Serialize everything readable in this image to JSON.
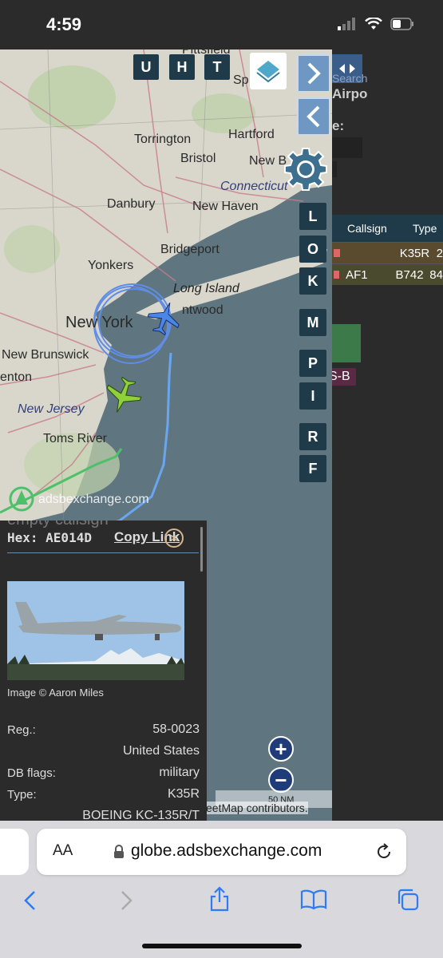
{
  "status_bar": {
    "time": "4:59"
  },
  "map": {
    "labels": {
      "torrington": "Torrington",
      "hartford": "Hartford",
      "bristol": "Bristol",
      "new_britain": "New B",
      "connecticut": "Connecticut",
      "danbury": "Danbury",
      "new_haven": "New Haven",
      "bridgeport": "Bridgeport",
      "yonkers": "Yonkers",
      "long_island": "Long Island",
      "brentwood": "ntwood",
      "new_york": "New York",
      "new_brunswick": "New Brunswick",
      "trenton": "enton",
      "new_jersey": "New Jersey",
      "toms_river": "Toms River",
      "pittsfield": "Pittsfield",
      "springfield": "Sp"
    },
    "top_buttons": [
      "U",
      "H",
      "T"
    ],
    "side_buttons": [
      "L",
      "O",
      "K",
      "M",
      "P",
      "I",
      "R",
      "F"
    ],
    "watermark": "adsbexchange.com",
    "scale": "50 NM",
    "attribution": "eetMap contributors.",
    "zoom_in": "+",
    "zoom_out": "−"
  },
  "right_panel": {
    "search_text": "Search",
    "airport_text": "Airpo",
    "colon_text": "e:",
    "table": {
      "headers": [
        "Callsign",
        "Type"
      ],
      "rows": [
        {
          "callsign": "",
          "type": "K35R",
          "extra": "2"
        },
        {
          "callsign": "AF1",
          "type": "B742",
          "extra": "84"
        }
      ]
    },
    "tag_text": "S-B",
    "slash_text": "/"
  },
  "info_panel": {
    "callsign_faded": "empty callsign",
    "hex": "Hex: AE014D",
    "copy_link": "Copy Link",
    "image_credit": "Image © Aaron Miles",
    "fields": [
      {
        "label": "Reg.:",
        "value": "58-0023"
      },
      {
        "label": "",
        "value": "United States"
      },
      {
        "label": "DB flags:",
        "value": "military"
      },
      {
        "label": "Type:",
        "value": "K35R"
      },
      {
        "label": "",
        "value": "BOEING KC-135R/T"
      }
    ]
  },
  "browser": {
    "text_size": "AA",
    "url": "globe.adsbexchange.com"
  },
  "colors": {
    "water": "#5f7680",
    "land": "#d8d6cf",
    "button": "#1f3b4a",
    "track_blue": "#5f8de6",
    "track_green": "#4ec06a",
    "plane_blue": "#4a86e8",
    "plane_green": "#8fd13b"
  }
}
